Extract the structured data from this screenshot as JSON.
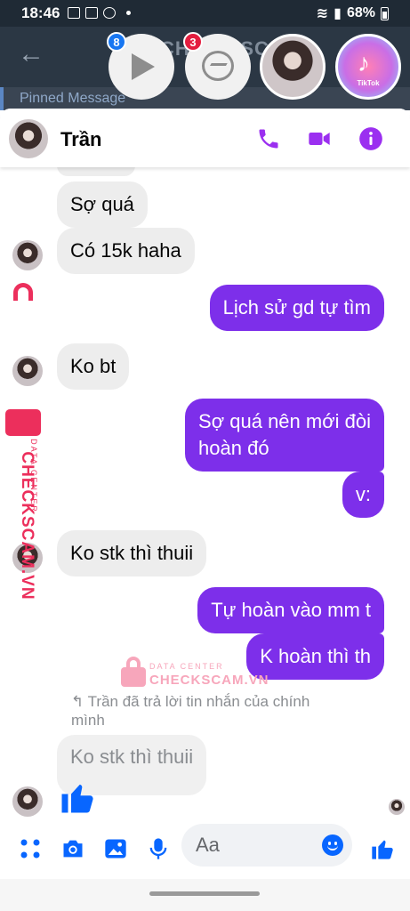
{
  "status_bar": {
    "time": "18:46",
    "battery": "68%"
  },
  "background_chat": {
    "title": "CHECK SCAM",
    "pinned_label": "Pinned Message"
  },
  "chat_heads": {
    "badges": [
      "8",
      "3"
    ],
    "tiktok_label": "TikTok"
  },
  "header": {
    "contact_name": "Trần"
  },
  "messages": [
    {
      "side": "in",
      "text": "Sợ quá"
    },
    {
      "side": "in",
      "text": "Có 15k haha"
    },
    {
      "side": "out",
      "text": "Lịch sử gd tự tìm"
    },
    {
      "side": "in",
      "text": "Ko bt"
    },
    {
      "side": "out",
      "text": "Sợ quá nên mới đòi\nhoàn đó"
    },
    {
      "side": "out",
      "text": "v:"
    },
    {
      "side": "in",
      "text": "Ko stk thì thuii"
    },
    {
      "side": "out",
      "text": "Tự hoàn vào mm t"
    },
    {
      "side": "out",
      "text": "K hoàn thì th"
    }
  ],
  "reply": {
    "note_line1": "Trần đã trả lời tin nhắn của chính",
    "note_line2": "mình",
    "quoted_text": "Ko stk thì thuii"
  },
  "composer": {
    "placeholder": "Aa"
  },
  "watermark": {
    "brand": "CHECKSCAM.VN",
    "sub": "DATA CENTER"
  },
  "colors": {
    "outgoing_bubble": "#7d2fea",
    "accent": "#9b2ff0",
    "like": "#0866ff"
  }
}
